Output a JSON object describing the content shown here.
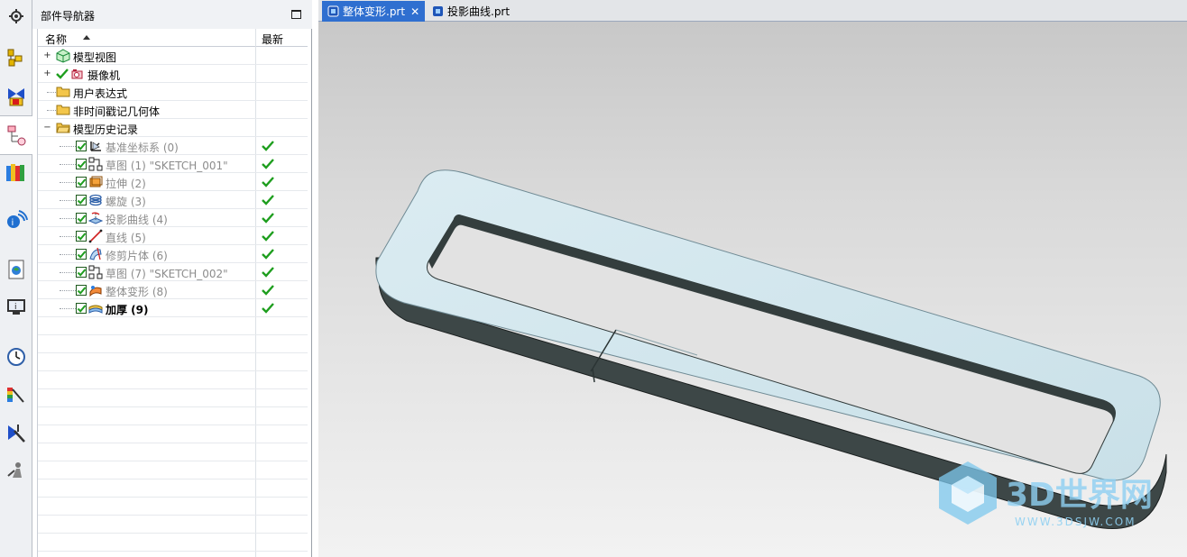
{
  "navigator": {
    "title": "部件导航器",
    "columns": {
      "name": "名称",
      "latest": "最新"
    },
    "top_nodes": [
      {
        "label": "模型视图"
      },
      {
        "label": "摄像机"
      },
      {
        "label": "用户表达式"
      },
      {
        "label": "非时间戳记几何体"
      },
      {
        "label": "模型历史记录"
      }
    ],
    "history": [
      {
        "label": "基准坐标系 (0)",
        "icon": "datum-csys-icon"
      },
      {
        "label": "草图 (1) \"SKETCH_001\"",
        "icon": "sketch-icon"
      },
      {
        "label": "拉伸 (2)",
        "icon": "extrude-icon"
      },
      {
        "label": "螺旋 (3)",
        "icon": "helix-icon"
      },
      {
        "label": "投影曲线 (4)",
        "icon": "project-curve-icon"
      },
      {
        "label": "直线 (5)",
        "icon": "line-icon"
      },
      {
        "label": "修剪片体 (6)",
        "icon": "trim-sheet-icon"
      },
      {
        "label": "草图 (7) \"SKETCH_002\"",
        "icon": "sketch-icon"
      },
      {
        "label": "整体变形 (8)",
        "icon": "global-shaping-icon"
      },
      {
        "label": "加厚 (9)",
        "icon": "thicken-icon"
      }
    ]
  },
  "tabs": [
    {
      "label": "整体变形.prt",
      "active": true
    },
    {
      "label": "投影曲线.prt",
      "active": false
    }
  ],
  "watermark": {
    "brand": "3D世界网",
    "url": "WWW.3DSJW.COM"
  },
  "colors": {
    "accent": "#2f6fd0",
    "check": "#1e9e1e",
    "part_face": "#d3e6ee",
    "part_side": "#3c4444"
  }
}
